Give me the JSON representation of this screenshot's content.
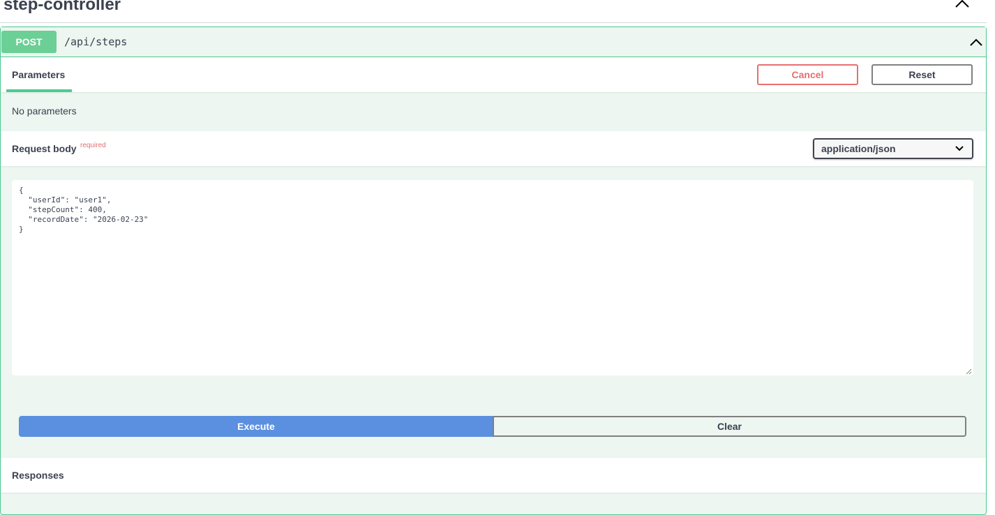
{
  "tag": {
    "title": "step-controller",
    "chevron_icon": "chevron-up-icon"
  },
  "operation": {
    "method": "POST",
    "path": "/api/steps",
    "method_color": "#49cc90",
    "chevron_icon": "chevron-up-icon"
  },
  "parameters": {
    "tab_label": "Parameters",
    "cancel_label": "Cancel",
    "reset_label": "Reset",
    "empty_text": "No parameters"
  },
  "request_body": {
    "title": "Request body",
    "required_label": "required",
    "content_type": "application/json",
    "body_text": "{\n  \"userId\": \"user1\",\n  \"stepCount\": 400,\n  \"recordDate\": \"2026-02-23\"\n}"
  },
  "actions": {
    "execute_label": "Execute",
    "clear_label": "Clear"
  },
  "responses": {
    "title": "Responses"
  }
}
